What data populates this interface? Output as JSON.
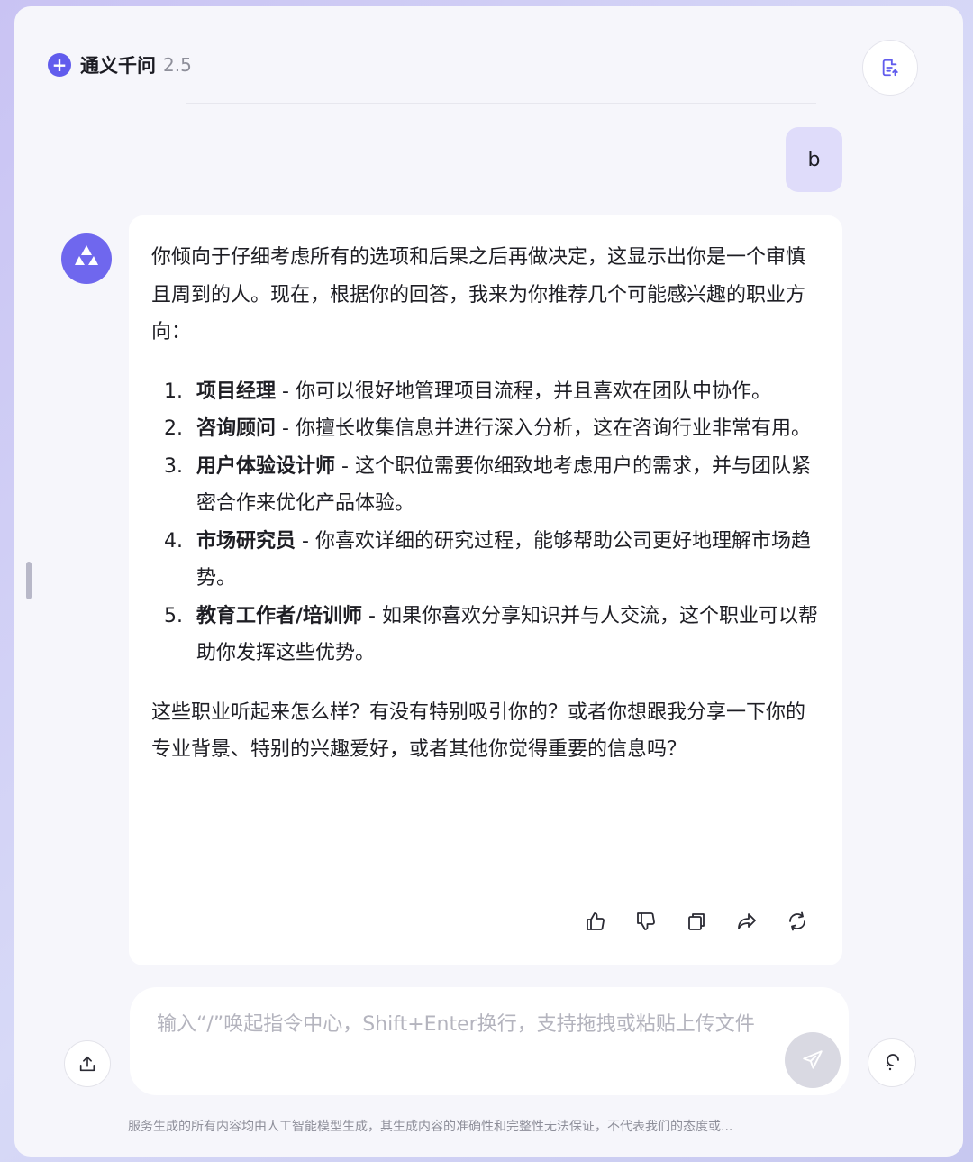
{
  "header": {
    "model_name": "通义千问",
    "model_version": "2.5",
    "icons": {
      "plus": "plus-icon",
      "new_doc": "document-upload-icon"
    }
  },
  "conversation": {
    "user_message": "b",
    "assistant": {
      "intro": "你倾向于仔细考虑所有的选项和后果之后再做决定，这显示出你是一个审慎且周到的人。现在，根据你的回答，我来为你推荐几个可能感兴趣的职业方向：",
      "items": [
        {
          "num": "1.",
          "title": "项目经理",
          "desc": " - 你可以很好地管理项目流程，并且喜欢在团队中协作。"
        },
        {
          "num": "2.",
          "title": "咨询顾问",
          "desc": " - 你擅长收集信息并进行深入分析，这在咨询行业非常有用。"
        },
        {
          "num": "3.",
          "title": "用户体验设计师",
          "desc": " - 这个职位需要你细致地考虑用户的需求，并与团队紧密合作来优化产品体验。"
        },
        {
          "num": "4.",
          "title": "市场研究员",
          "desc": " - 你喜欢详细的研究过程，能够帮助公司更好地理解市场趋势。"
        },
        {
          "num": "5.",
          "title": "教育工作者/培训师",
          "desc": " - 如果你喜欢分享知识并与人交流，这个职业可以帮助你发挥这些优势。"
        }
      ],
      "outro": "这些职业听起来怎么样？有没有特别吸引你的？或者你想跟我分享一下你的专业背景、特别的兴趣爱好，或者其他你觉得重要的信息吗？",
      "action_icons": [
        "thumbs-up-icon",
        "thumbs-down-icon",
        "copy-icon",
        "share-icon",
        "regenerate-icon"
      ]
    }
  },
  "input": {
    "placeholder": "输入“/”唤起指令中心，Shift+Enter换行，支持拖拽或粘贴上传文件",
    "icons": {
      "upload": "upload-icon",
      "send": "send-icon",
      "voice": "voice-icon"
    }
  },
  "footer": {
    "disclaimer": "服务生成的所有内容均由人工智能模型生成，其生成内容的准确性和完整性无法保证，不代表我们的态度或..."
  },
  "colors": {
    "accent": "#615ced",
    "user_bubble": "#dfdcfa",
    "card": "#ffffff",
    "send_disabled": "#d9d9e2"
  }
}
